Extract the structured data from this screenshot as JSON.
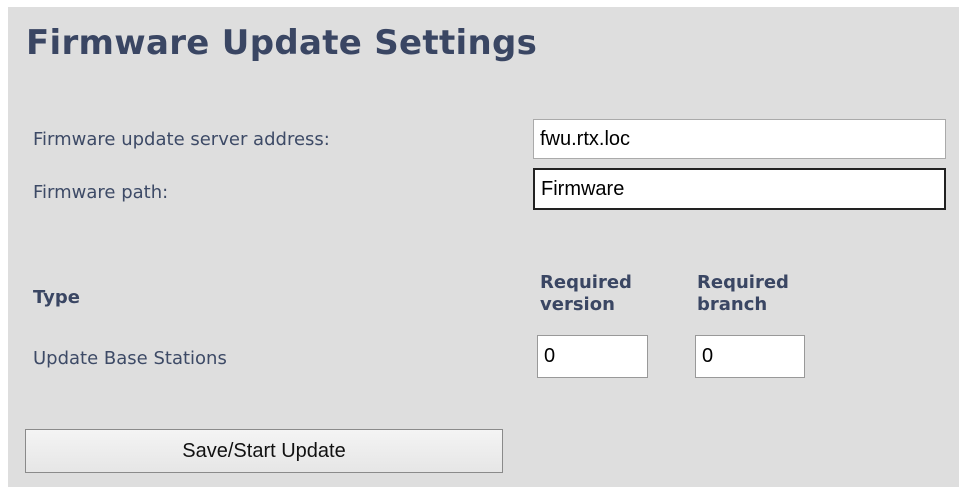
{
  "page": {
    "title": "Firmware Update Settings"
  },
  "server": {
    "label": "Firmware update server address:",
    "value": "fwu.rtx.loc"
  },
  "path": {
    "label": "Firmware path:",
    "value": "Firmware"
  },
  "table": {
    "type_header": "Type",
    "version_header_line1": "Required",
    "version_header_line2": "version",
    "branch_header_line1": "Required",
    "branch_header_line2": "branch",
    "rows": [
      {
        "label": "Update Base Stations",
        "version": "0",
        "branch": "0"
      }
    ]
  },
  "actions": {
    "save_label": "Save/Start Update"
  }
}
